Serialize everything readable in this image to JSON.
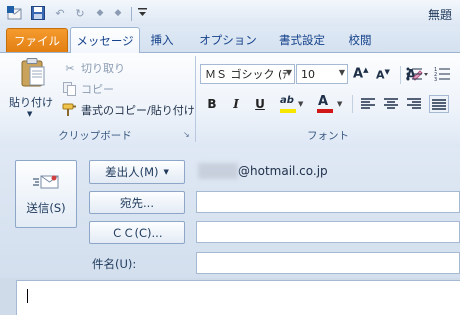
{
  "window": {
    "title": "無題"
  },
  "quick_access": {
    "icons": [
      "outlook-icon",
      "save-icon",
      "undo-icon",
      "redo-icon",
      "up-arrow-icon",
      "down-arrow-icon",
      "customize-icon"
    ]
  },
  "tabs": [
    {
      "label": "ファイル"
    },
    {
      "label": "メッセージ"
    },
    {
      "label": "挿入"
    },
    {
      "label": "オプション"
    },
    {
      "label": "書式設定"
    },
    {
      "label": "校閲"
    }
  ],
  "clipboard": {
    "paste_label": "貼り付け",
    "cut_label": "切り取り",
    "copy_label": "コピー",
    "format_painter_label": "書式のコピー/貼り付け",
    "group_label": "クリップボード"
  },
  "font": {
    "family_value": "ＭＳ ゴシック (ﾃ",
    "size_value": "10",
    "group_label": "フォント",
    "bold": "B",
    "italic": "I",
    "underline": "U"
  },
  "colors": {
    "highlight": "#f7e600",
    "font_color": "#d01818",
    "file_tab": "#e8841a"
  },
  "message": {
    "send_label": "送信(S)",
    "from_label": "差出人(M)",
    "from_value": "@hotmail.co.jp",
    "to_label": "宛先...",
    "cc_label": "ＣＣ(C)...",
    "subject_label": "件名(U):"
  }
}
